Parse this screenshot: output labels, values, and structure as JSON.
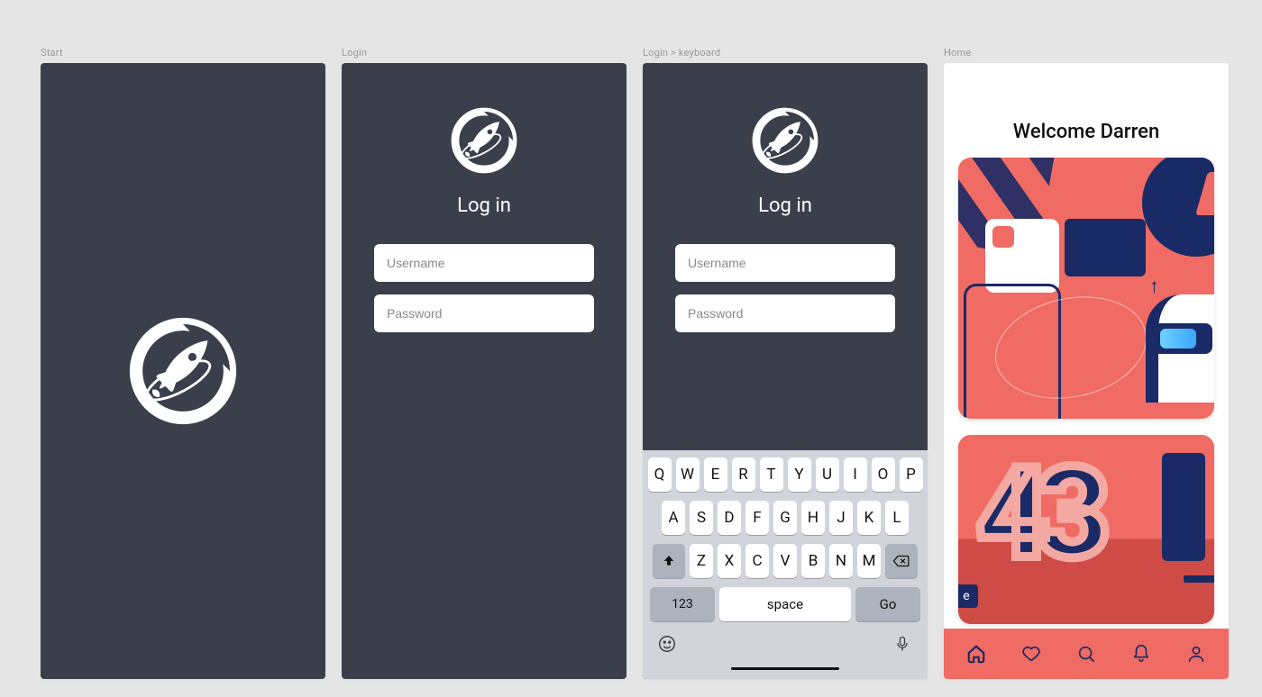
{
  "frames": {
    "start": {
      "label": "Start"
    },
    "login": {
      "label": "Login",
      "title": "Log in",
      "username_placeholder": "Username",
      "password_placeholder": "Password"
    },
    "login_kb": {
      "label": "Login > keyboard"
    },
    "home": {
      "label": "Home",
      "welcome": "Welcome Darren",
      "card2_letter": "e"
    }
  },
  "keyboard": {
    "row1": [
      "Q",
      "W",
      "E",
      "R",
      "T",
      "Y",
      "U",
      "I",
      "O",
      "P"
    ],
    "row2": [
      "A",
      "S",
      "D",
      "F",
      "G",
      "H",
      "J",
      "K",
      "L"
    ],
    "row3": [
      "Z",
      "X",
      "C",
      "V",
      "B",
      "N",
      "M"
    ],
    "num": "123",
    "space": "space",
    "go": "Go"
  },
  "tabs": {
    "home": "home-icon",
    "heart": "heart-icon",
    "search": "search-icon",
    "bell": "bell-icon",
    "user": "user-icon"
  },
  "colors": {
    "dark": "#3a3f4b",
    "accent": "#ef6b63",
    "navy": "#1a2a66"
  }
}
